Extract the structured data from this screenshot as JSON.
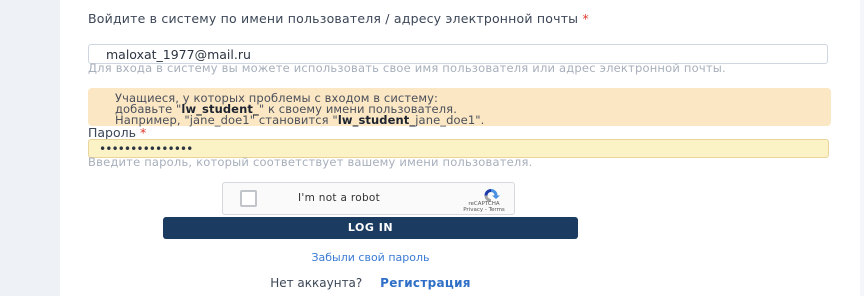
{
  "login": {
    "username_label": "Войдите в систему по имени пользователя / адресу электронной почты",
    "required_mark": "*",
    "username_value": "maloxat_1977@mail.ru",
    "username_hint": "Для входа в систему вы можете использовать свое имя пользователя или адрес электронной почты.",
    "alert_line1": "Учащиеся, у которых проблемы с входом в систему:",
    "alert_line2_prefix": "добавьте \"",
    "alert_line2_bold": "lw_student_",
    "alert_line2_suffix": "\" к своему имени пользователя.",
    "alert_line3_prefix": "Например, \"jane_doe1\" становится \"",
    "alert_line3_bold": "lw_student_",
    "alert_line3_suffix": "jane_doe1\".",
    "password_label": "Пароль",
    "password_value": "•••••••••••••••",
    "password_hint": "Введите пароль, который соответствует вашему имени пользователя.",
    "captcha_label": "I'm not a robot",
    "captcha_brand": "reCAPTCHA",
    "captcha_links": "Privacy - Terms",
    "login_button": "LOG IN",
    "forgot_password": "Забыли свой пароль",
    "no_account": "Нет аккаунта?",
    "register": "Регистрация"
  },
  "colors": {
    "primary_button": "#1c3b61",
    "alert_bg": "#fbe7c4",
    "password_bg": "#fbf2c6",
    "link": "#3a7bd5",
    "required": "#e0392b"
  }
}
